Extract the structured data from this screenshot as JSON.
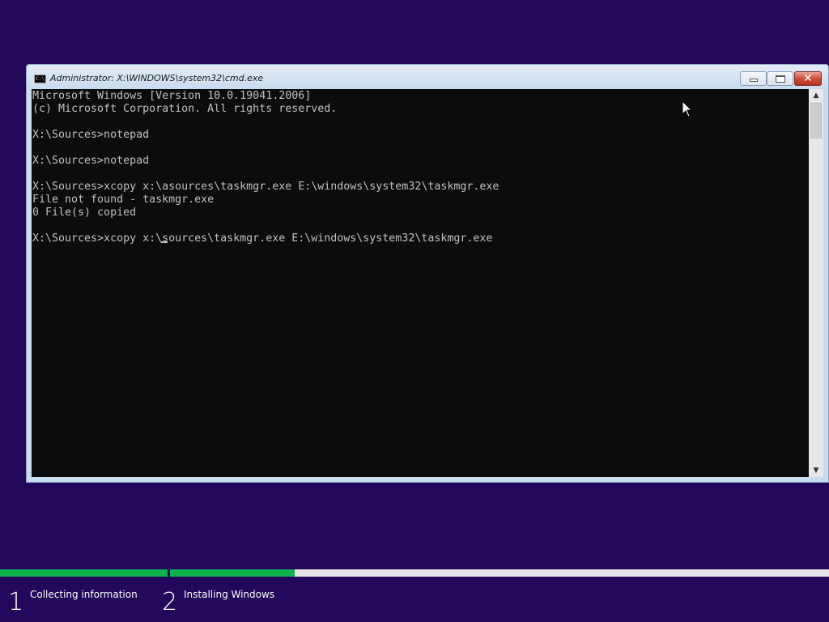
{
  "window": {
    "title": "Administrator: X:\\WINDOWS\\system32\\cmd.exe",
    "icon_text": "C:\\",
    "buttons": {
      "minimize": "minimize-icon",
      "maximize": "maximize-icon",
      "close": "✕"
    }
  },
  "console": {
    "lines": [
      "Microsoft Windows [Version 10.0.19041.2006]",
      "(c) Microsoft Corporation. All rights reserved.",
      "",
      "X:\\Sources>notepad",
      "",
      "X:\\Sources>notepad",
      "",
      "X:\\Sources>xcopy x:\\asources\\taskmgr.exe E:\\windows\\system32\\taskmgr.exe",
      "File not found - taskmgr.exe",
      "0 File(s) copied",
      "",
      "X:\\Sources>xcopy x:\\sources\\taskmgr.exe E:\\windows\\system32\\taskmgr.exe"
    ],
    "text_color": "#c0c0c0",
    "background": "#0c0c0c"
  },
  "setup": {
    "progress_color": "#0fb14f",
    "steps": [
      {
        "number": "1",
        "label": "Collecting information",
        "complete": 1.0
      },
      {
        "number": "2",
        "label": "Installing Windows",
        "complete": 0.19
      }
    ]
  },
  "desktop": {
    "background": "#22075a"
  }
}
